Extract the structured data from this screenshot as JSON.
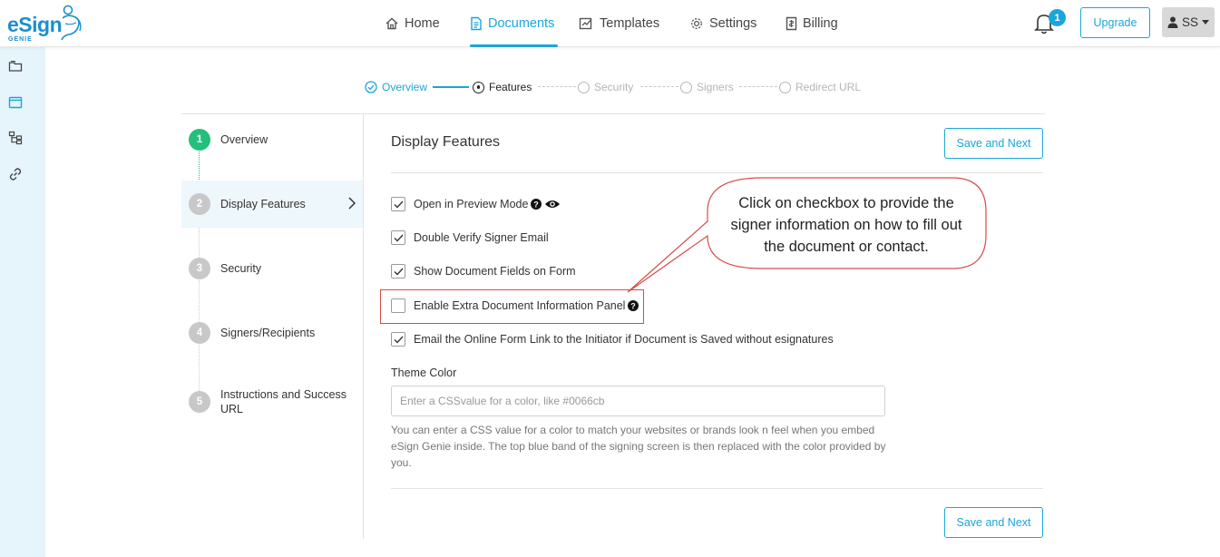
{
  "logo": {
    "word": "eSign",
    "sub": "GENIE"
  },
  "nav": {
    "items": [
      {
        "label": "Home",
        "icon": "home-icon"
      },
      {
        "label": "Documents",
        "icon": "document-icon",
        "active": true
      },
      {
        "label": "Templates",
        "icon": "templates-icon"
      },
      {
        "label": "Settings",
        "icon": "gear-icon"
      },
      {
        "label": "Billing",
        "icon": "billing-icon"
      }
    ],
    "notifications": "1",
    "upgrade_label": "Upgrade",
    "user_initials": "SS"
  },
  "rail": {
    "icons": [
      "folders-icon",
      "window-icon",
      "sitemap-icon",
      "link-icon"
    ]
  },
  "stepper": {
    "steps": [
      {
        "label": "Overview",
        "state": "done"
      },
      {
        "label": "Features",
        "state": "current"
      },
      {
        "label": "Security",
        "state": "todo"
      },
      {
        "label": "Signers",
        "state": "todo"
      },
      {
        "label": "Redirect URL",
        "state": "todo"
      }
    ]
  },
  "left_steps": [
    {
      "num": "1",
      "label": "Overview"
    },
    {
      "num": "2",
      "label": "Display Features"
    },
    {
      "num": "3",
      "label": "Security"
    },
    {
      "num": "4",
      "label": "Signers/Recipients"
    },
    {
      "num": "5",
      "label": "Instructions and Success URL"
    }
  ],
  "panel": {
    "title": "Display Features",
    "save_next_label": "Save and Next",
    "options": [
      {
        "label": "Open in Preview Mode",
        "checked": true
      },
      {
        "label": "Double Verify Signer Email",
        "checked": true
      },
      {
        "label": "Show Document Fields on Form",
        "checked": true
      },
      {
        "label": "Enable Extra Document Information Panel",
        "checked": false
      },
      {
        "label": "Email the Online Form Link to the Initiator if Document is Saved without esignatures",
        "checked": true
      }
    ],
    "theme_label": "Theme Color",
    "theme_placeholder": "Enter a CSSvalue for a color, like #0066cb",
    "theme_help": "You can enter a CSS value for a color to match your websites or brands look n feel when you embed eSign Genie inside. The top blue band of the signing screen is then replaced with the color provided by you."
  },
  "callout": {
    "text": "Click on checkbox to provide the signer information on how to fill out the document or contact."
  },
  "colors": {
    "accent": "#1ba6d9",
    "success": "#22c07a",
    "callout_border": "#d84b4b"
  }
}
